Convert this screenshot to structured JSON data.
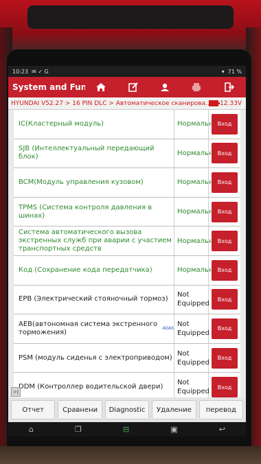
{
  "status_bar": {
    "time": "10:23",
    "battery": "71 %"
  },
  "title_bar": {
    "title": "System and Function",
    "icons": [
      "home-icon",
      "report-icon",
      "user-icon",
      "print-icon",
      "exit-icon"
    ]
  },
  "breadcrumb": {
    "path": "HYUNDAI V52.27 > 16 PIN DLC > Автоматическое сканирова...",
    "voltage": "12.33V"
  },
  "list": {
    "enter_label": "Вход",
    "rows": [
      {
        "name": "IC(Кластерный модуль)",
        "status": "Нормально",
        "color": "green"
      },
      {
        "name": "SJB (Интеллектуальный передающий блок)",
        "status": "Нормально",
        "color": "green"
      },
      {
        "name": "BCM(Модуль управления кузовом)",
        "status": "Нормально",
        "color": "green"
      },
      {
        "name": "TPMS (Система контроля давления в шинах)",
        "status": "Нормально",
        "color": "green"
      },
      {
        "name": "Система автоматического вызова экстренных служб при аварии с участием транспортных средств",
        "status": "Нормально",
        "color": "green"
      },
      {
        "name": "Код (Сохранение кода передатчика)",
        "status": "Нормально",
        "color": "green"
      },
      {
        "name": "EPB (Электрический стояночный тормоз)",
        "status": "Not Equipped",
        "color": "black"
      },
      {
        "name": "AEB(автономная система экстренного торможения)",
        "status": "Not Equipped",
        "color": "black",
        "badge": "ADAS"
      },
      {
        "name": "PSM (модуль сиденья с электроприводом)",
        "status": "Not Equipped",
        "color": "black"
      },
      {
        "name": "DDM (Контроллер водительской двери)",
        "status": "Not Equipped",
        "color": "black"
      }
    ]
  },
  "actions": {
    "report": "Отчет",
    "compare": "Сравнени",
    "diagnostic": "Diagnostic",
    "delete": "Удаление",
    "translate": "перевод"
  },
  "side_tab": "≻|",
  "colors": {
    "accent": "#c5202b",
    "ok_text": "#2f8a2f",
    "breadcrumb_text": "#d01b1b"
  }
}
